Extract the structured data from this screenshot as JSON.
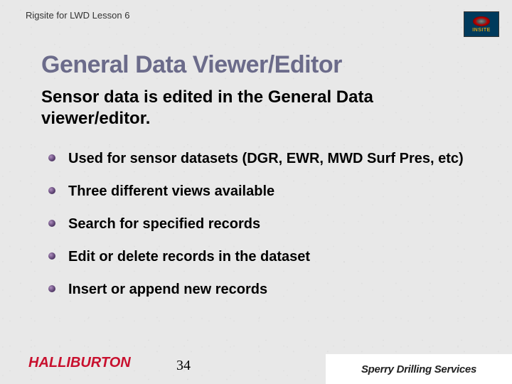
{
  "header": {
    "lesson_label": "Rigsite for LWD Lesson 6",
    "insite_label": "INSITE"
  },
  "title": "General Data Viewer/Editor",
  "subtitle": "Sensor data is edited in the General Data viewer/editor.",
  "bullets": [
    "Used for sensor datasets (DGR, EWR, MWD Surf Pres, etc)",
    "Three different views available",
    "Search for specified records",
    "Edit or delete records in the dataset",
    "Insert or append new records"
  ],
  "footer": {
    "halliburton": "HALLIBURTON",
    "page_number": "34",
    "sperry": "Sperry Drilling Services"
  }
}
